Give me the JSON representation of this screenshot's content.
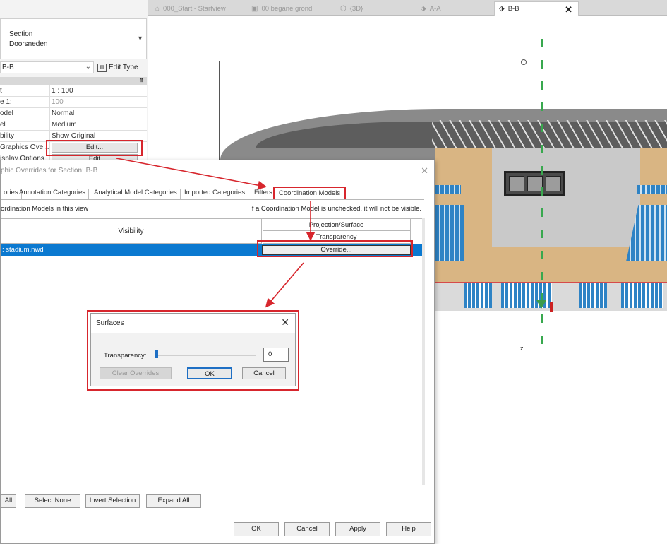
{
  "tabs": [
    {
      "icon": "house-icon",
      "label": "000_Start - Startview"
    },
    {
      "icon": "floor-plan-icon",
      "label": "00 begane grond"
    },
    {
      "icon": "3d-view-icon",
      "label": "{3D}"
    },
    {
      "icon": "section-icon",
      "label": "A-A"
    },
    {
      "icon": "section-icon",
      "label": "B-B"
    }
  ],
  "active_tab_close": "✕",
  "properties": {
    "type_line1": "Section",
    "type_line2": "Doorsneden",
    "instance": "B-B",
    "edit_type": "Edit Type",
    "rows": [
      {
        "key": "t",
        "value": "1 : 100"
      },
      {
        "key": "e    1:",
        "value": "100",
        "muted": true
      },
      {
        "key": "odel",
        "value": "Normal"
      },
      {
        "key": "el",
        "value": "Medium"
      },
      {
        "key": "bility",
        "value": "Show Original"
      },
      {
        "key": "Graphics Ove...",
        "button": "Edit..."
      },
      {
        "key": "isplay Options",
        "button": "Edit"
      }
    ]
  },
  "vg_dialog": {
    "title": "phic Overrides for Section: B-B",
    "close": "✕",
    "tabs": [
      "ories",
      "Annotation Categories",
      "Analytical Model Categories",
      "Imported Categories",
      "Filters",
      "Coordination Models"
    ],
    "description": "ordination Models in this view",
    "hint": "If a Coordination Model is unchecked, it will not be visible.",
    "col_visibility": "Visibility",
    "col_projection": "Projection/Surface",
    "col_transparency": "Transparency",
    "row_name": ": stadium.nwd",
    "override_label": "Override...",
    "buttons": [
      "All",
      "Select None",
      "Invert Selection",
      "Expand All"
    ],
    "footer": [
      "OK",
      "Cancel",
      "Apply",
      "Help"
    ]
  },
  "surfaces": {
    "title": "Surfaces",
    "close": "✕",
    "transparency_label": "Transparency:",
    "transparency_value": "0",
    "transparency_level": 0,
    "clear_overrides": "Clear Overrides",
    "ok": "OK",
    "cancel": "Cancel"
  },
  "colors": {
    "highlight": "#d7262d",
    "selection": "#0b79d0",
    "grid": "#38a84e"
  }
}
